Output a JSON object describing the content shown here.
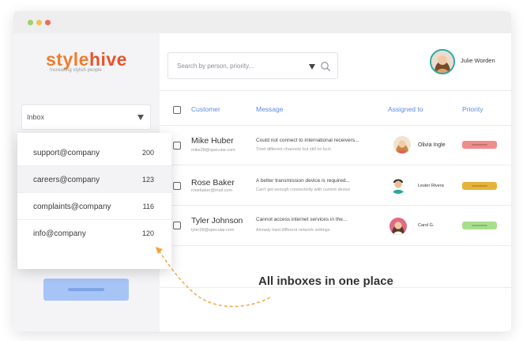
{
  "app": {
    "logo_part1": "style",
    "logo_part2": "hive",
    "tagline": "Increasing stylish people"
  },
  "sidebar": {
    "select_label": "Inbox"
  },
  "dropdown": {
    "items": [
      {
        "name": "support@company",
        "count": "200"
      },
      {
        "name": "careers@company",
        "count": "123"
      },
      {
        "name": "complaints@company",
        "count": "116"
      },
      {
        "name": "info@company",
        "count": "120"
      }
    ]
  },
  "search": {
    "placeholder": "Search by person, priority..."
  },
  "user": {
    "name": "Julie Worden"
  },
  "table": {
    "headers": {
      "customer": "Customer",
      "message": "Message",
      "assigned": "Assigned to",
      "priority": "Priority"
    },
    "rows": [
      {
        "name": "Mike Huber",
        "email": "mike28@specular.com",
        "message": "Could not connect to international receivers...",
        "detail": "Tried different channels but still no luck.",
        "agent": "Olivia Ingle",
        "priority_color": "#ef8c8c"
      },
      {
        "name": "Rose Baker",
        "email": "rosebaker@mail.com",
        "message": "A better transmission device is required...",
        "detail": "Can't get enough connectivity with current device",
        "agent": "Lester Rivera",
        "priority_color": "#e8b23a"
      },
      {
        "name": "Tyler Johnson",
        "email": "tyler28@specular.com",
        "message": "Cannot access internet services in the...",
        "detail": "Already tried different network settings",
        "agent": "Carol G.",
        "priority_color": "#a8df8c"
      }
    ]
  },
  "annotation": {
    "text": "All inboxes in one place"
  },
  "colors": {
    "accent": "#5b8de6",
    "logo_orange": "#f07d2a",
    "logo_red": "#e8542c",
    "button": "#a7c4f6",
    "arrow": "#f2a33a"
  }
}
